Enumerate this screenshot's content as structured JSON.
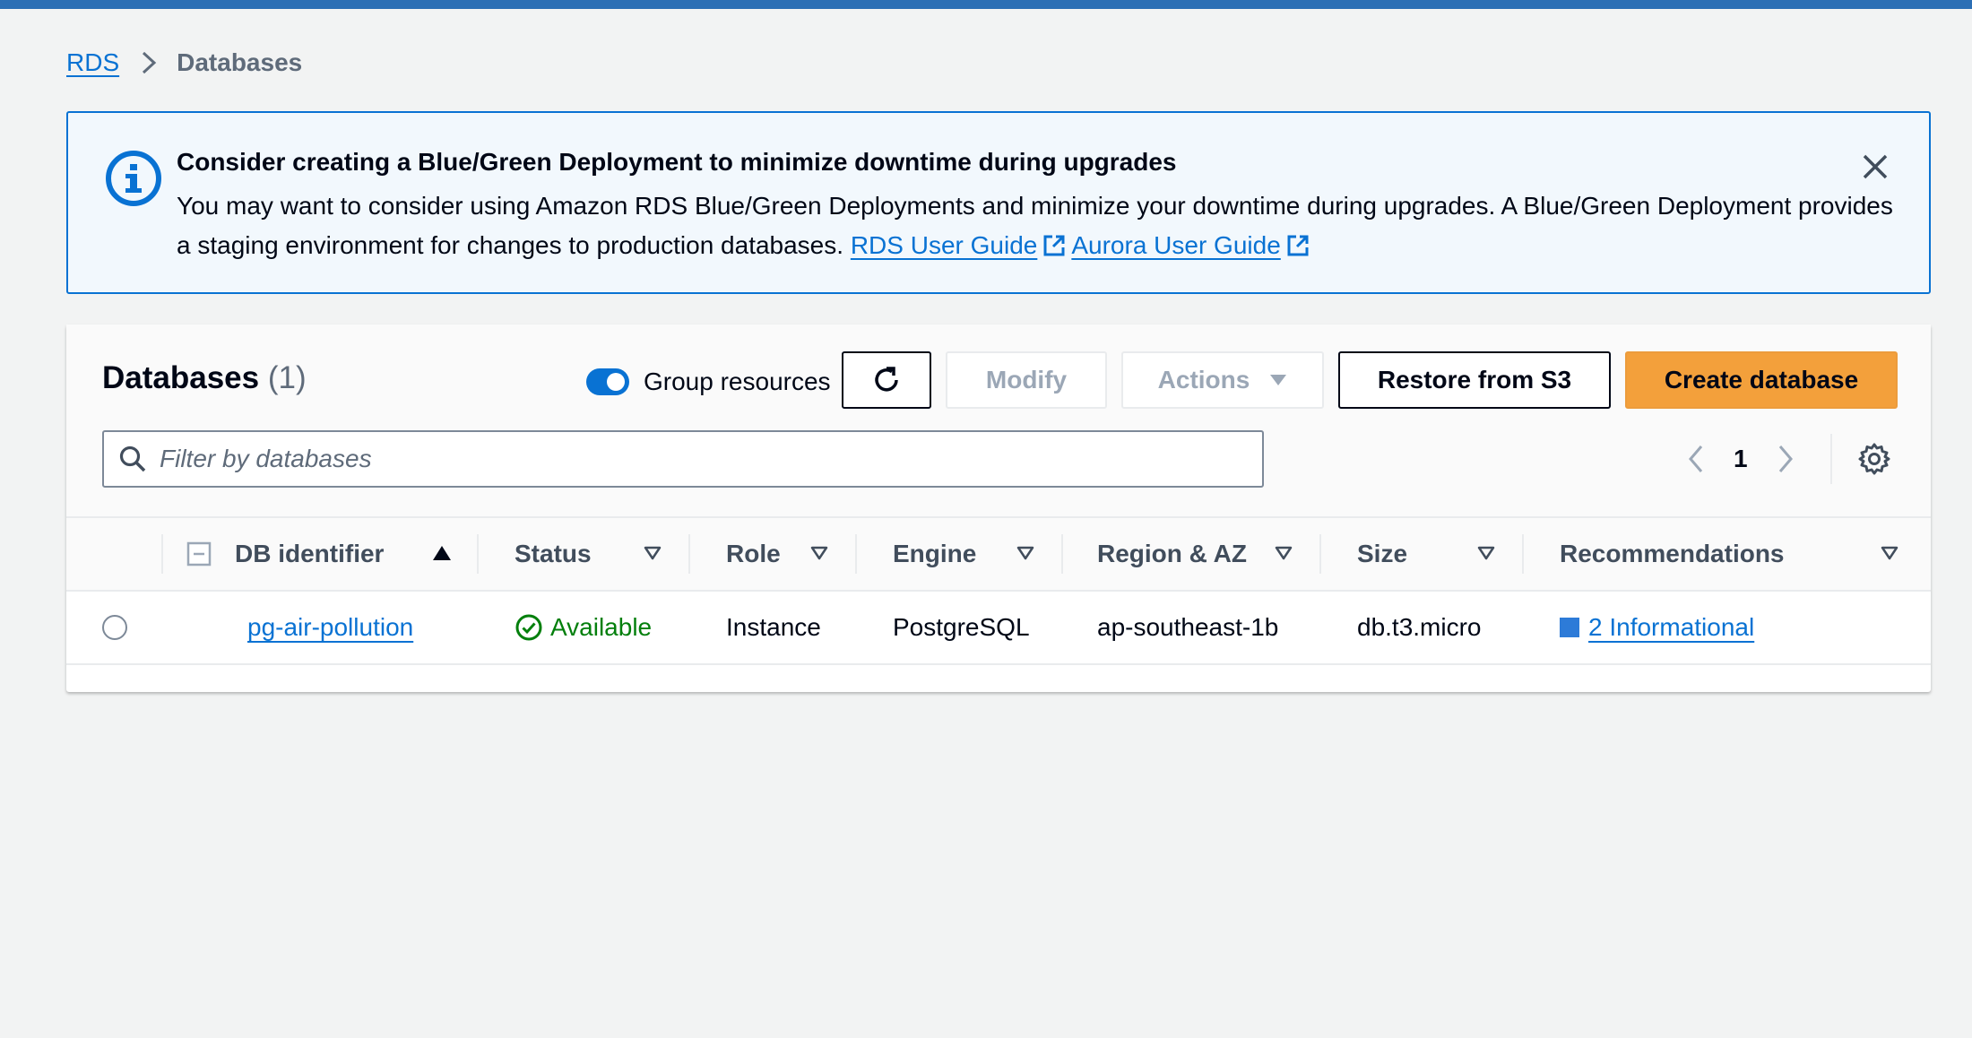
{
  "breadcrumb": {
    "root": "RDS",
    "current": "Databases"
  },
  "alert": {
    "title": "Consider creating a Blue/Green Deployment to minimize downtime during upgrades",
    "body": "You may want to consider using Amazon RDS Blue/Green Deployments and minimize your downtime during upgrades. A Blue/Green Deployment provides a staging environment for changes to production databases.",
    "link1": "RDS User Guide",
    "link2": "Aurora User Guide"
  },
  "panel": {
    "title": "Databases",
    "count": "(1)",
    "toggle_label": "Group resources",
    "toggle_on": true,
    "buttons": {
      "modify": "Modify",
      "actions": "Actions",
      "restore": "Restore from S3",
      "create": "Create database"
    },
    "filter_placeholder": "Filter by databases",
    "page_number": "1"
  },
  "table": {
    "columns": [
      "DB identifier",
      "Status",
      "Role",
      "Engine",
      "Region & AZ",
      "Size",
      "Recommendations"
    ],
    "rows": [
      {
        "identifier": "pg-air-pollution",
        "status": "Available",
        "role": "Instance",
        "engine": "PostgreSQL",
        "region": "ap-southeast-1b",
        "size": "db.t3.micro",
        "recommendations": "2 Informational"
      }
    ]
  },
  "colors": {
    "accent": "#0972d3",
    "primary_button": "#f3a03b",
    "success": "#037f0c",
    "top_bar": "#2c6fb5"
  },
  "icons": [
    "info-icon",
    "close-icon",
    "external-link-icon",
    "refresh-icon",
    "caret-down-icon",
    "search-icon",
    "chevron-left-icon",
    "chevron-right-icon",
    "gear-icon",
    "sort-ascending-icon",
    "filter-caret-icon",
    "check-circle-icon"
  ]
}
